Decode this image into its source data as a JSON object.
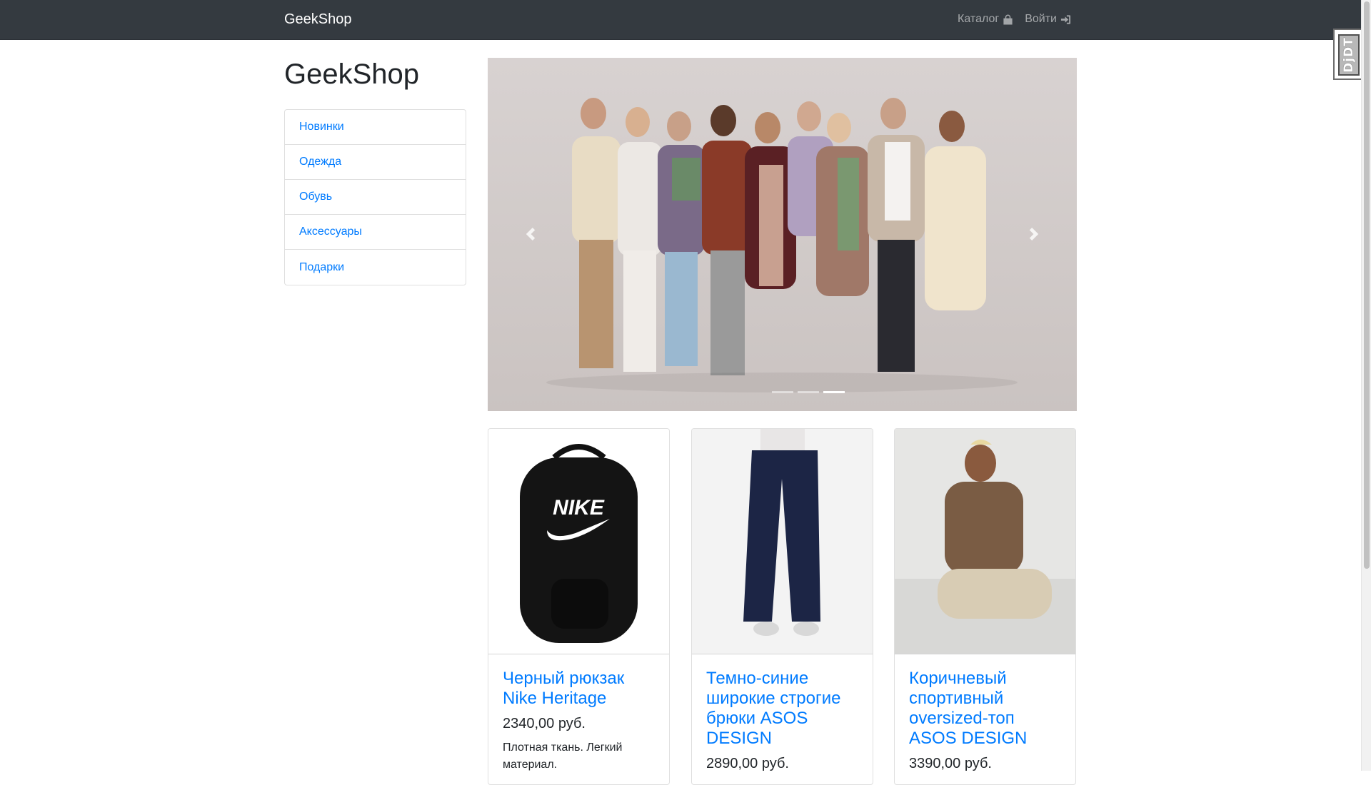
{
  "navbar": {
    "brand": "GeekShop",
    "links": [
      {
        "label": "Каталог",
        "icon": "shopping-bag-icon"
      },
      {
        "label": "Войти",
        "icon": "sign-in-icon"
      }
    ]
  },
  "debug_toolbar": {
    "label": "DjDT"
  },
  "sidebar": {
    "title": "GeekShop",
    "categories": [
      "Новинки",
      "Одежда",
      "Обувь",
      "Аксессуары",
      "Подарки"
    ]
  },
  "carousel": {
    "indicators": 3,
    "active_index": 2
  },
  "products": [
    {
      "title": "Черный рюкзак Nike Heritage",
      "price": "2340,00 руб.",
      "description": "Плотная ткань. Легкий материал."
    },
    {
      "title": "Темно-синие широкие строгие брюки ASOS DESIGN",
      "price": "2890,00 руб.",
      "description": ""
    },
    {
      "title": "Коричневый спортивный oversized-топ ASOS DESIGN",
      "price": "3390,00 руб.",
      "description": ""
    }
  ]
}
